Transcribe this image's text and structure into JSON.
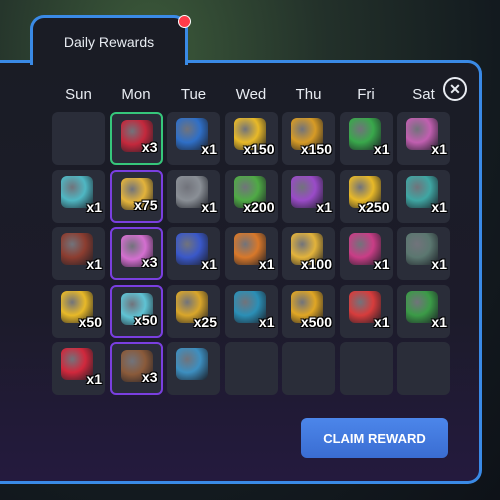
{
  "tab": {
    "label": "Daily Rewards"
  },
  "days": [
    "Sun",
    "Mon",
    "Tue",
    "Wed",
    "Thu",
    "Fri",
    "Sat"
  ],
  "cells": [
    {
      "icon": "empty",
      "qty": "",
      "color": "#2a2d39",
      "state": "empty"
    },
    {
      "icon": "ruby-gem-icon",
      "qty": "x3",
      "color": "#c4283c",
      "state": "green"
    },
    {
      "icon": "blue-horn-icon",
      "qty": "x1",
      "color": "#2f6fc7",
      "state": ""
    },
    {
      "icon": "gold-star-icon",
      "qty": "x150",
      "color": "#e8b928",
      "state": ""
    },
    {
      "icon": "gold-ticket-icon",
      "qty": "x150",
      "color": "#d79b25",
      "state": ""
    },
    {
      "icon": "mystery-card-icon",
      "qty": "x1",
      "color": "#39a84b",
      "state": ""
    },
    {
      "icon": "rainbow-horn-icon",
      "qty": "x1",
      "color": "#c15fb0",
      "state": ""
    },
    {
      "icon": "double-xp-icon",
      "qty": "x1",
      "color": "#4fb7c3",
      "state": ""
    },
    {
      "icon": "gold-coin-stack-icon",
      "qty": "x75",
      "color": "#e3b33b",
      "state": "purple"
    },
    {
      "icon": "plant-pot-icon",
      "qty": "x1",
      "color": "#8a8f96",
      "state": ""
    },
    {
      "icon": "cash-stack-icon",
      "qty": "x200",
      "color": "#4faa45",
      "state": ""
    },
    {
      "icon": "wild-card-icon",
      "qty": "x1",
      "color": "#9a4bc8",
      "state": ""
    },
    {
      "icon": "gold-star-icon",
      "qty": "x250",
      "color": "#e8b928",
      "state": ""
    },
    {
      "icon": "xp-boost-icon",
      "qty": "x1",
      "color": "#3fa6a3",
      "state": ""
    },
    {
      "icon": "ice-cream-sundae-icon",
      "qty": "x1",
      "color": "#8c3d30",
      "state": ""
    },
    {
      "icon": "rainbow-egg-icon",
      "qty": "x3",
      "color": "#d46fd0",
      "state": "purple"
    },
    {
      "icon": "golden-clock-icon",
      "qty": "x1",
      "color": "#3a58c9",
      "state": ""
    },
    {
      "icon": "orange-wrap-icon",
      "qty": "x1",
      "color": "#d8782a",
      "state": ""
    },
    {
      "icon": "gold-coin-pile-icon",
      "qty": "x100",
      "color": "#e3b33b",
      "state": ""
    },
    {
      "icon": "money-bag-card-icon",
      "qty": "x1",
      "color": "#c93d86",
      "state": ""
    },
    {
      "icon": "safe-icon",
      "qty": "x1",
      "color": "#5b7770",
      "state": ""
    },
    {
      "icon": "gold-star-icon",
      "qty": "x50",
      "color": "#e8b928",
      "state": ""
    },
    {
      "icon": "lightning-card-icon",
      "qty": "x50",
      "color": "#5fc3d4",
      "state": "purple"
    },
    {
      "icon": "gold-coin-icon",
      "qty": "x25",
      "color": "#d9a62a",
      "state": ""
    },
    {
      "icon": "teal-ball-icon",
      "qty": "x1",
      "color": "#2b8fb6",
      "state": ""
    },
    {
      "icon": "gold-bars-icon",
      "qty": "x500",
      "color": "#e0a624",
      "state": ""
    },
    {
      "icon": "jester-hat-icon",
      "qty": "x1",
      "color": "#d73c3c",
      "state": ""
    },
    {
      "icon": "green-wreath-icon",
      "qty": "x1",
      "color": "#3b9b47",
      "state": ""
    },
    {
      "icon": "heart-card-icon",
      "qty": "x1",
      "color": "#d1283c",
      "state": ""
    },
    {
      "icon": "wood-shield-icon",
      "qty": "x3",
      "color": "#8a5a3a",
      "state": "purple"
    },
    {
      "icon": "golden-frame-icon",
      "qty": "",
      "color": "#3d8fc0",
      "state": ""
    },
    {
      "icon": "empty",
      "qty": "",
      "color": "#2a2d39",
      "state": "empty"
    },
    {
      "icon": "empty",
      "qty": "",
      "color": "#2a2d39",
      "state": "empty"
    },
    {
      "icon": "empty",
      "qty": "",
      "color": "#2a2d39",
      "state": "empty"
    },
    {
      "icon": "empty",
      "qty": "",
      "color": "#2a2d39",
      "state": "empty"
    }
  ],
  "claim_button": {
    "label": "CLAIM REWARD"
  },
  "colors": {
    "accent": "#3a8ae6",
    "notification": "#ff3b4a",
    "highlight_green": "#36c77b",
    "highlight_purple": "#7a3fe0"
  }
}
